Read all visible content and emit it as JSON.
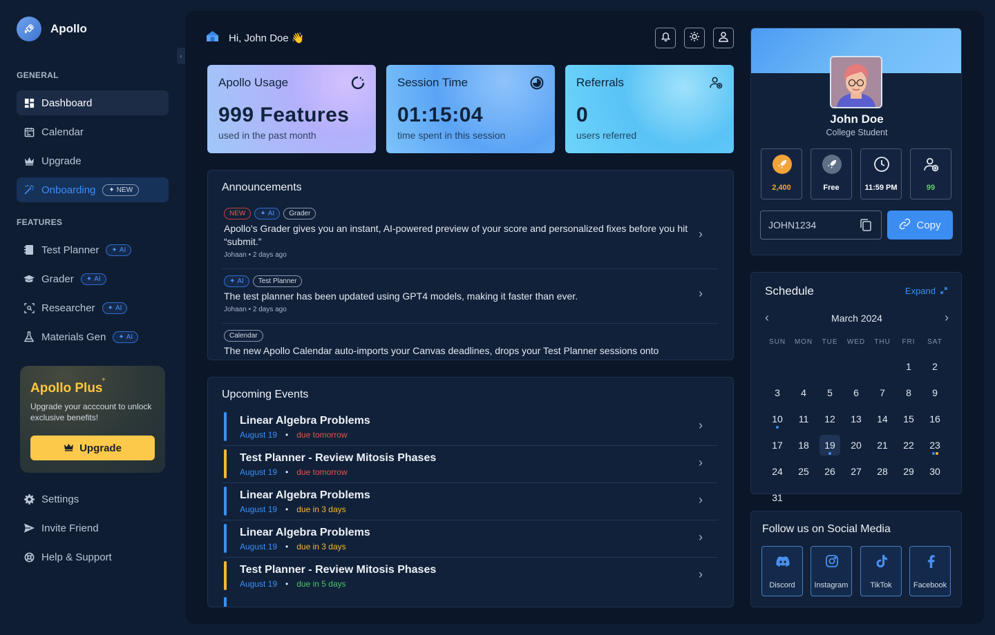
{
  "brand": {
    "name": "Apollo"
  },
  "sidebar": {
    "general_label": "GENERAL",
    "features_label": "FEATURES",
    "general_items": [
      {
        "label": "Dashboard"
      },
      {
        "label": "Calendar"
      },
      {
        "label": "Upgrade"
      },
      {
        "label": "Onboarding",
        "badge": "NEW"
      }
    ],
    "feature_items": [
      {
        "label": "Test Planner",
        "badge": "AI"
      },
      {
        "label": "Grader",
        "badge": "AI"
      },
      {
        "label": "Researcher",
        "badge": "AI"
      },
      {
        "label": "Materials Gen",
        "badge": "AI"
      }
    ],
    "bottom_items": [
      {
        "label": "Settings"
      },
      {
        "label": "Invite Friend"
      },
      {
        "label": "Help & Support"
      }
    ],
    "plus": {
      "title": "Apollo Plus",
      "star": "+",
      "text": "Upgrade your acccount to unlock exclusive benefits!",
      "button": "Upgrade"
    }
  },
  "header": {
    "greeting": "Hi, John Doe 👋"
  },
  "stats": [
    {
      "title": "Apollo Usage",
      "value": "999 Features",
      "sub": "used in the past month"
    },
    {
      "title": "Session Time",
      "value": "01:15:04",
      "sub": "time spent in this session"
    },
    {
      "title": "Referrals",
      "value": "0",
      "sub": "users referred"
    }
  ],
  "announcements": {
    "title": "Announcements",
    "items": [
      {
        "tags": [
          "NEW",
          "AI",
          "Grader"
        ],
        "text": "Apollo's Grader gives you an instant, AI-powered preview of your score and personalized fixes before you hit “submit.”",
        "meta": "Johaan • 2 days ago"
      },
      {
        "tags": [
          "AI",
          "Test Planner"
        ],
        "text": "The test planner has been updated using GPT4 models, making it faster than ever.",
        "meta": "Johaan • 2 days ago"
      },
      {
        "tags": [
          "Calendar"
        ],
        "text": "The new Apollo Calendar auto-imports your Canvas deadlines, drops your Test Planner sessions onto",
        "meta": ""
      }
    ]
  },
  "events": {
    "title": "Upcoming Events",
    "items": [
      {
        "title": "Linear Algebra Problems",
        "date": "August 19",
        "due": "due tomorrow",
        "color": "#3a8ff5",
        "due_color": "#e5534b"
      },
      {
        "title": "Test Planner - Review Mitosis Phases",
        "date": "August 19",
        "due": "due tomorrow",
        "color": "#f5b82e",
        "due_color": "#e5534b"
      },
      {
        "title": "Linear Algebra Problems",
        "date": "August 19",
        "due": "due in 3 days",
        "color": "#3a8ff5",
        "due_color": "#f5b82e"
      },
      {
        "title": "Linear Algebra Problems",
        "date": "August 19",
        "due": "due in 3 days",
        "color": "#3a8ff5",
        "due_color": "#f5b82e"
      },
      {
        "title": "Test Planner - Review Mitosis Phases",
        "date": "August 19",
        "due": "due in 5 days",
        "color": "#f5b82e",
        "due_color": "#4cc46a"
      }
    ]
  },
  "profile": {
    "name": "John Doe",
    "role": "College Student",
    "stats": [
      {
        "value": "2,400",
        "icon": "rocket-icon",
        "color": "#f5a623"
      },
      {
        "value": "Free",
        "icon": "rocket-icon",
        "color": "#ffffff"
      },
      {
        "value": "11:59 PM",
        "icon": "clock-icon",
        "color": "#ffffff"
      },
      {
        "value": "99",
        "icon": "user-plus-icon",
        "color": "#5fd068"
      }
    ],
    "referral_code": "JOHN1234",
    "copy_label": "Copy"
  },
  "schedule": {
    "title": "Schedule",
    "expand": "Expand",
    "month": "March 2024",
    "weekdays": [
      "SUN",
      "MON",
      "TUE",
      "WED",
      "THU",
      "FRI",
      "SAT"
    ],
    "today": 19
  },
  "social": {
    "title": "Follow us on Social Media",
    "items": [
      "Discord",
      "Instagram",
      "TikTok",
      "Facebook"
    ]
  }
}
